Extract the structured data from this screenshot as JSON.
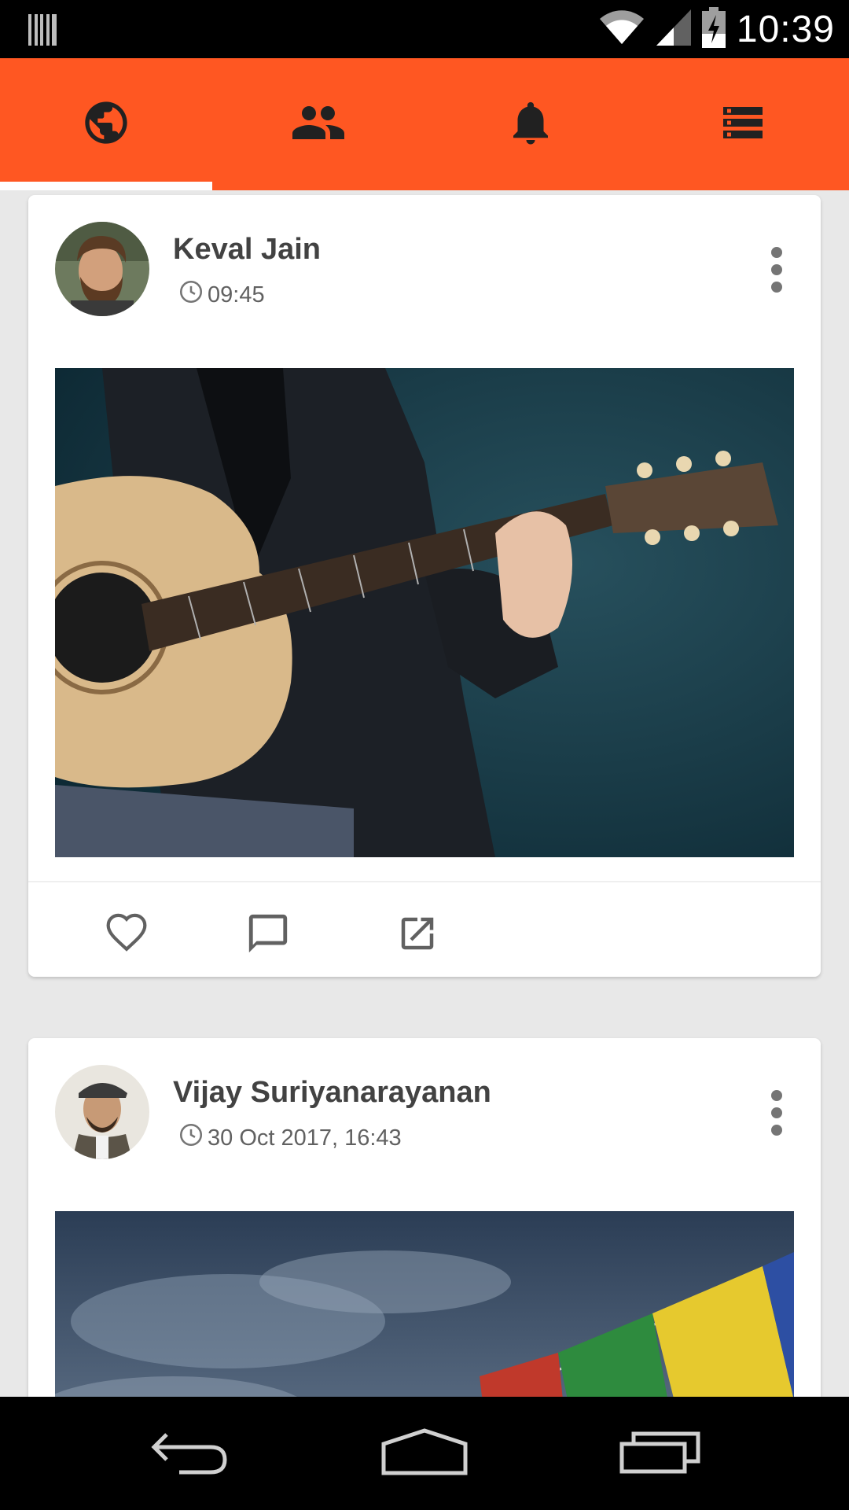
{
  "status_bar": {
    "time": "10:39",
    "icons": [
      "barcode-icon",
      "wifi-icon",
      "signal-icon",
      "battery-charging-icon"
    ]
  },
  "tabs": [
    {
      "name": "globe-icon",
      "active": true
    },
    {
      "name": "people-icon",
      "active": false
    },
    {
      "name": "bell-icon",
      "active": false
    },
    {
      "name": "storage-icon",
      "active": false
    }
  ],
  "colors": {
    "accent": "#ff5722",
    "background": "#e8e8e8",
    "card": "#ffffff",
    "icon_dark": "#212121",
    "icon_gray": "#616161"
  },
  "posts": [
    {
      "author": "Keval Jain",
      "time": "09:45",
      "image": "guitar-photo",
      "actions": [
        "heart-icon",
        "comment-icon",
        "open-external-icon"
      ]
    },
    {
      "author": "Vijay Suriyanarayanan",
      "time": "30 Oct 2017, 16:43",
      "image": "sky-prayer-flags-photo"
    }
  ],
  "nav_bar": [
    "back-icon",
    "home-icon",
    "recents-icon"
  ]
}
